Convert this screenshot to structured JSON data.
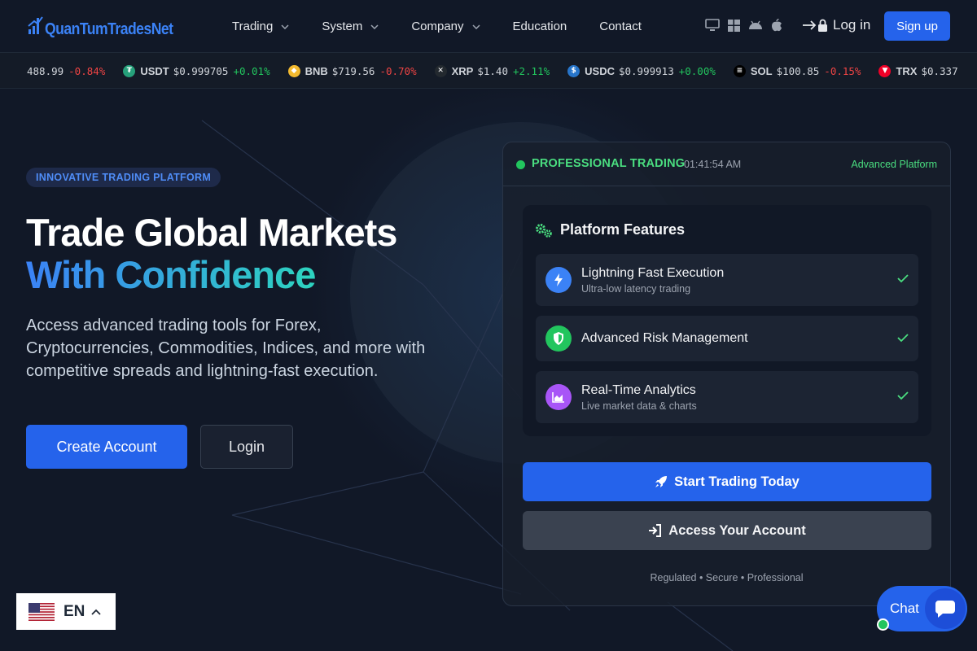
{
  "nav": {
    "logo_text": "QuanTumTradesNet",
    "menu": [
      {
        "label": "Trading",
        "has_dropdown": true
      },
      {
        "label": "System",
        "has_dropdown": true
      },
      {
        "label": "Company",
        "has_dropdown": true
      },
      {
        "label": "Education",
        "has_dropdown": false
      },
      {
        "label": "Contact",
        "has_dropdown": false
      }
    ],
    "platform_icons": [
      "desktop-icon",
      "windows-icon",
      "android-icon",
      "apple-icon"
    ],
    "login_label": "Log in",
    "signup_label": "Sign up"
  },
  "ticker": [
    {
      "symbol": "",
      "price": "488.99",
      "change": "-0.84%",
      "direction": "down",
      "icon": ""
    },
    {
      "symbol": "USDT",
      "price": "$0.999705",
      "change": "+0.01%",
      "direction": "up",
      "icon": "tether-icon",
      "color": "#26a17b"
    },
    {
      "symbol": "BNB",
      "price": "$719.56",
      "change": "-0.70%",
      "direction": "down",
      "icon": "bnb-icon",
      "color": "#f3ba2f"
    },
    {
      "symbol": "XRP",
      "price": "$1.40",
      "change": "+2.11%",
      "direction": "up",
      "icon": "xrp-icon",
      "color": "#23292f"
    },
    {
      "symbol": "USDC",
      "price": "$0.999913",
      "change": "+0.00%",
      "direction": "up",
      "icon": "usdc-icon",
      "color": "#2775ca"
    },
    {
      "symbol": "SOL",
      "price": "$100.85",
      "change": "-0.15%",
      "direction": "down",
      "icon": "solana-icon",
      "color": "#000000"
    },
    {
      "symbol": "TRX",
      "price": "$0.337",
      "change": "",
      "direction": "down",
      "icon": "tron-icon",
      "color": "#ef0027"
    }
  ],
  "hero": {
    "badge": "INNOVATIVE TRADING PLATFORM",
    "title_line1": "Trade Global Markets",
    "title_line2": "With Confidence",
    "lead": "Access advanced trading tools for Forex, Cryptocurrencies, Commodities, Indices, and more with competitive spreads and lightning-fast execution.",
    "create_label": "Create Account",
    "login_label": "Login"
  },
  "panel": {
    "status_label": "PROFESSIONAL TRADING",
    "time": "01:41:54 AM",
    "tag": "Advanced Platform",
    "features_title": "Platform Features",
    "features": [
      {
        "title": "Lightning Fast Execution",
        "subtitle": "Ultra-low latency trading",
        "icon": "lightning-icon",
        "color": "#3b82f6"
      },
      {
        "title": "Advanced Risk Management",
        "subtitle": "",
        "icon": "shield-icon",
        "color": "#22c55e"
      },
      {
        "title": "Real-Time Analytics",
        "subtitle": "Live market data & charts",
        "icon": "chart-icon",
        "color": "#a855f7"
      }
    ],
    "cta_primary": "Start Trading Today",
    "cta_secondary": "Access Your Account",
    "footer": "Regulated • Secure • Professional"
  },
  "language": {
    "code": "EN"
  },
  "chat": {
    "label": "Chat"
  },
  "colors": {
    "accent": "#2563eb",
    "success": "#22c55e",
    "danger": "#ef4444",
    "background": "#111827"
  }
}
